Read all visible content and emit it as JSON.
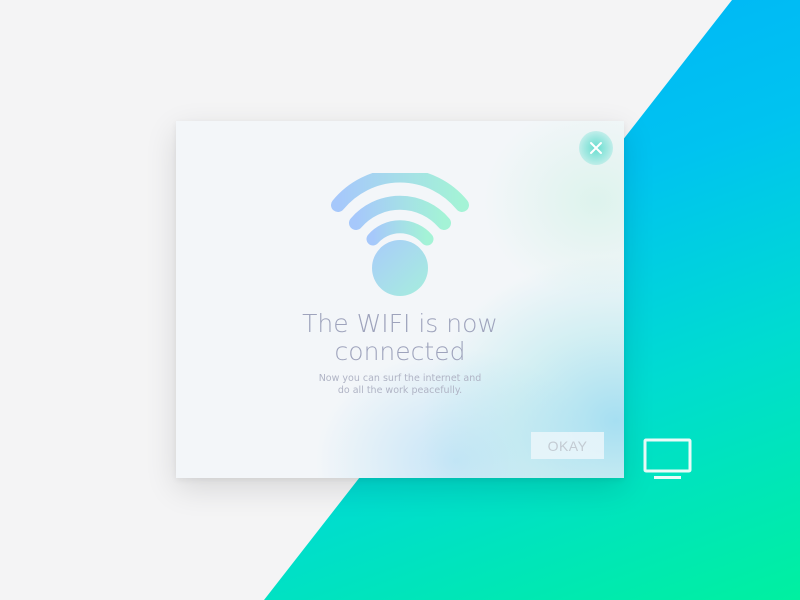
{
  "dialog": {
    "title_line1": "The WIFI is now",
    "title_line2": "connected",
    "subtitle_line1": "Now you can surf the internet and",
    "subtitle_line2": "do all the work peacefully.",
    "okay_label": "OKAY",
    "close_icon": "close-icon",
    "wifi_icon": "wifi-icon"
  },
  "background": {
    "monitor_icon": "monitor-icon"
  },
  "colors": {
    "gradient_blue": "#00a8ff",
    "gradient_green": "#00f0a0",
    "title_text": "#9ea3bc",
    "page_background": "#f4f4f5"
  }
}
